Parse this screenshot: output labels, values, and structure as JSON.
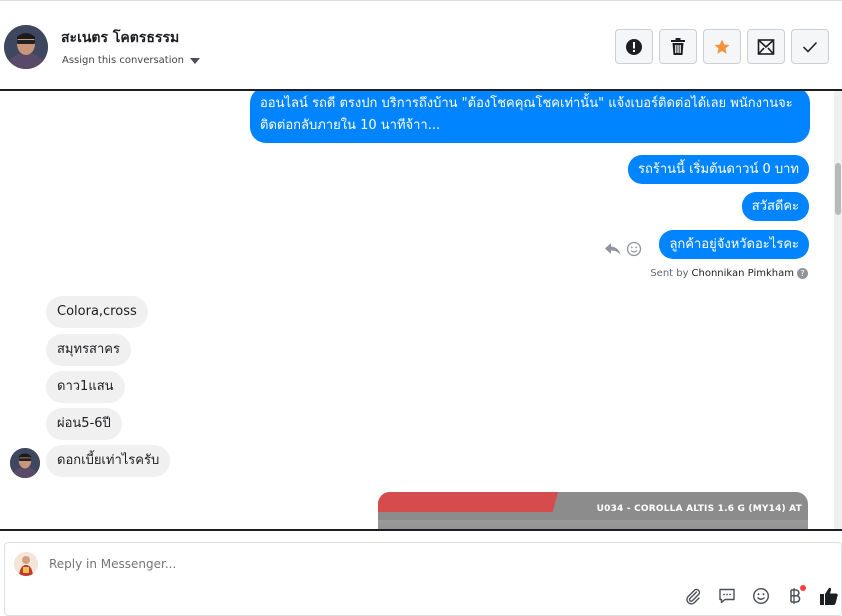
{
  "header": {
    "contact_name": "สะเนตร โคตรธรรม",
    "assign_label": "Assign this conversation",
    "actions": [
      {
        "name": "mark-spam",
        "icon": "exclamation-icon"
      },
      {
        "name": "delete",
        "icon": "trash-icon"
      },
      {
        "name": "star",
        "icon": "star-icon",
        "color": "#f5923e"
      },
      {
        "name": "mark-unread",
        "icon": "envelope-icon"
      },
      {
        "name": "mark-done",
        "icon": "check-icon"
      }
    ]
  },
  "messages": {
    "outgoing_long": "ออนไลน์ รถดี ตรงปก บริการถึงบ้าน \"ต้องโชคคุณโชคเท่านั้น\" แจ้งเบอร์ติดต่อได้เลย พนักงานจะติดต่อกลับภายใน 10 นาทีจ้าา...",
    "outgoing_1": "รถร้านนี้ เริ่มต้นดาวน์ 0 บาท",
    "outgoing_2": "สวัสดีคะ",
    "outgoing_3": "ลูกค้าอยู่จังหวัดอะไรคะ",
    "sent_by_prefix": "Sent by",
    "sent_by_name": "Chonnikan Pimkham",
    "help_glyph": "?",
    "incoming": [
      "Colora,cross",
      "สมุทรสาคร",
      "ดาว1แสน",
      "ผ่อน5-6ปี",
      "ดอกเบี้ยเท่าไรครับ"
    ],
    "image_caption": "U034 - COROLLA ALTIS 1.6 G (MY14) AT"
  },
  "composer": {
    "placeholder": "Reply in Messenger...",
    "tools": [
      "paperclip-icon",
      "chat-bubble-icon",
      "emoji-icon",
      "baht-icon",
      "thumbs-up-icon"
    ]
  },
  "colors": {
    "outgoing_bubble": "#0084ff",
    "incoming_bubble": "#f1f0f0",
    "star_accent": "#f5923e",
    "like_icon": "#1c1e21"
  }
}
